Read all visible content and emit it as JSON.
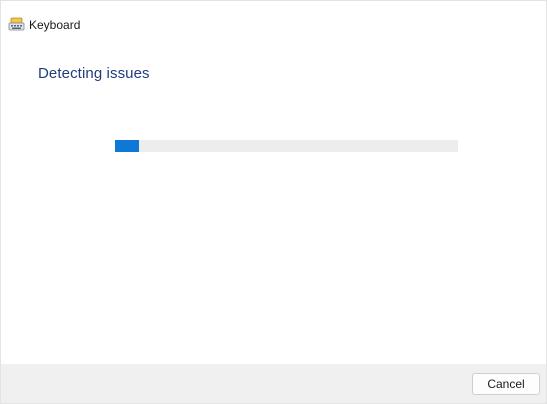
{
  "window": {
    "title": "Keyboard",
    "icon": "keyboard-troubleshooter-icon"
  },
  "main": {
    "heading": "Detecting issues",
    "progress": {
      "value_percent": 7,
      "color": "#0f78d4"
    }
  },
  "footer": {
    "cancel_label": "Cancel"
  },
  "colors": {
    "heading": "#1f3d7a",
    "accent": "#0f78d4",
    "footer_bg": "#f0f0f0"
  }
}
